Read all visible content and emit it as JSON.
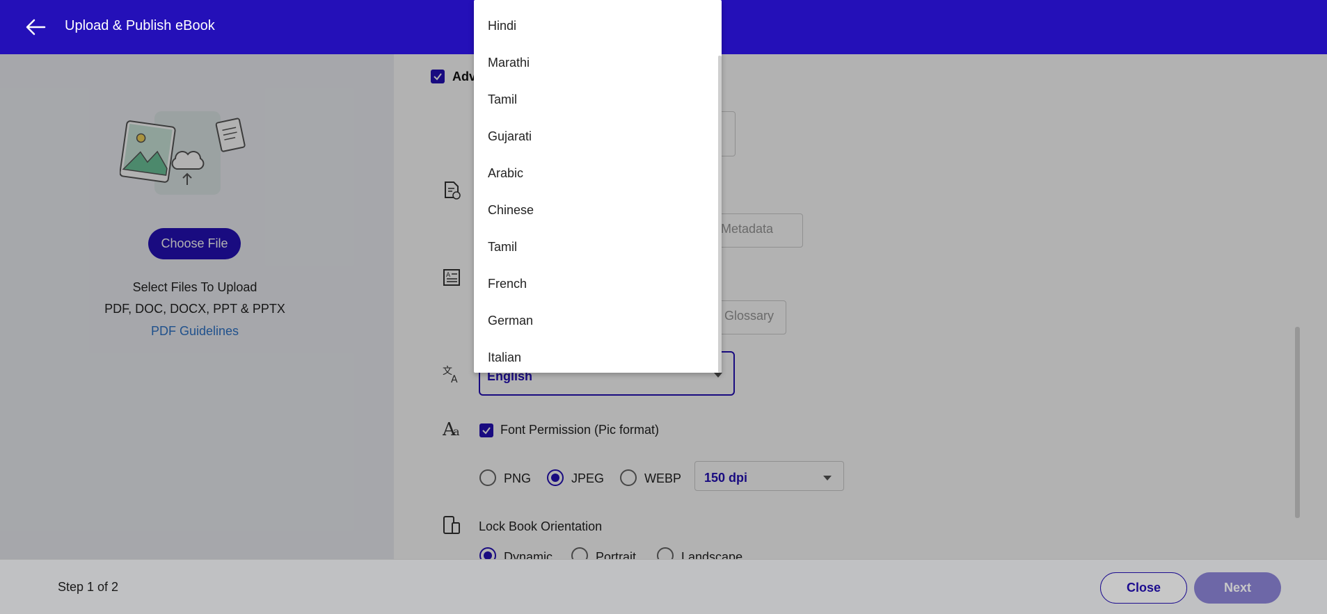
{
  "header": {
    "title": "Upload & Publish eBook"
  },
  "left": {
    "choose_label": "Choose File",
    "line1": "Select Files To Upload",
    "line2": "PDF, DOC, DOCX, PPT & PPTX",
    "guidelines_link": "PDF Guidelines"
  },
  "main": {
    "advanced_label": "Adv",
    "metadata_btn_fragment": "d Metadata",
    "glossary_btn_fragment": "Glossary",
    "language_value": "English",
    "font_permission_label": "Font Permission (Pic format)",
    "formats": [
      {
        "label": "PNG",
        "selected": false
      },
      {
        "label": "JPEG",
        "selected": true
      },
      {
        "label": "WEBP",
        "selected": false
      }
    ],
    "dpi_value": "150 dpi",
    "orientation_label": "Lock Book Orientation",
    "orientations": [
      {
        "label": "Dynamic",
        "selected": true
      },
      {
        "label": "Portrait",
        "selected": false
      },
      {
        "label": "Landscape",
        "selected": false
      }
    ]
  },
  "dropdown": {
    "options": [
      "Hindi",
      "Marathi",
      "Tamil",
      "Gujarati",
      "Arabic",
      "Chinese",
      "Tamil",
      "French",
      "German",
      "Italian"
    ]
  },
  "footer": {
    "step": "Step 1 of 2",
    "close_label": "Close",
    "next_label": "Next"
  }
}
